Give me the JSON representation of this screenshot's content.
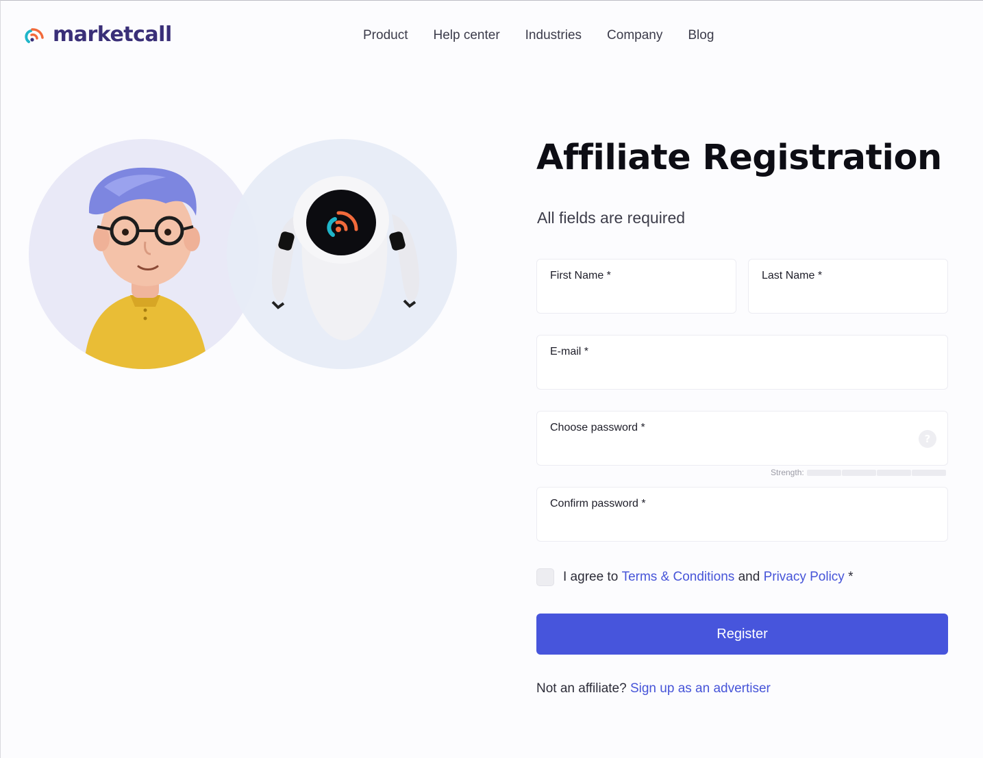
{
  "header": {
    "logo_text": "marketcall",
    "logo_icon": "marketcall-signal-logo",
    "nav": [
      "Product",
      "Help center",
      "Industries",
      "Company",
      "Blog"
    ]
  },
  "illustration": {
    "left_avatar": "person-avatar-with-glasses",
    "right_avatar": "robot-avatar"
  },
  "form": {
    "title": "Affiliate Registration",
    "subtitle": "All fields are required",
    "first_name": {
      "label": "First Name *",
      "value": ""
    },
    "last_name": {
      "label": "Last Name *",
      "value": ""
    },
    "email": {
      "label": "E-mail *",
      "value": ""
    },
    "password": {
      "label": "Choose password *",
      "value": "",
      "help_icon": "question-icon"
    },
    "strength": {
      "label": "Strength:",
      "level": 0,
      "segments": 4
    },
    "confirm_password": {
      "label": "Confirm password *",
      "value": ""
    },
    "agree": {
      "prefix": "I agree to",
      "terms_link": "Terms & Conditions",
      "middle": "and",
      "privacy_link": "Privacy Policy",
      "suffix": " *",
      "checked": false
    },
    "register_button": "Register",
    "footer": {
      "text": "Not an affiliate? ",
      "link": "Sign up as an advertiser"
    }
  },
  "colors": {
    "brand_dark": "#3a2f78",
    "accent": "#4755dc",
    "link": "#4654d8",
    "logo_orange": "#f26a3b",
    "logo_teal": "#1fb5c9"
  }
}
